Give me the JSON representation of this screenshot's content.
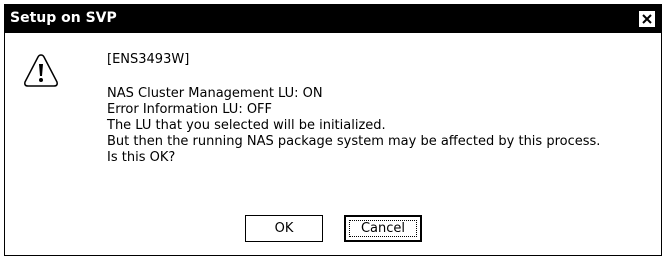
{
  "window": {
    "title": "Setup on SVP",
    "close_icon": "close-icon"
  },
  "message": {
    "icon": "warning-icon",
    "code": "[ENS3493W]",
    "lines": [
      "NAS Cluster Management LU: ON",
      "Error Information LU: OFF",
      "The LU that you selected will be initialized.",
      "But then the running NAS package system may be affected by this process.",
      "Is this OK?"
    ]
  },
  "buttons": {
    "ok_label": "OK",
    "cancel_label": "Cancel"
  }
}
